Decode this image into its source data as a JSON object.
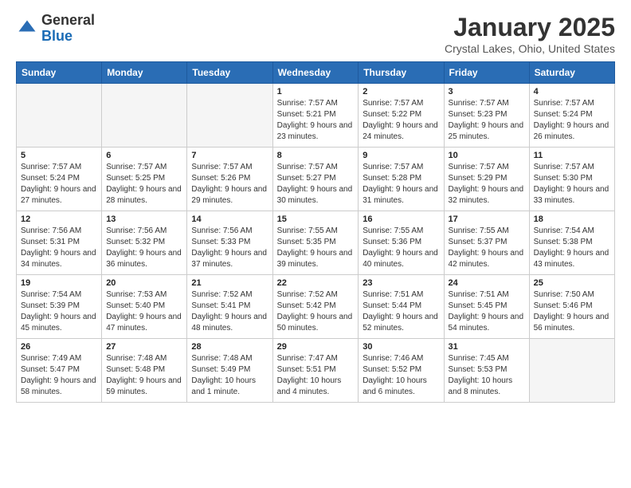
{
  "header": {
    "logo_general": "General",
    "logo_blue": "Blue",
    "month": "January 2025",
    "location": "Crystal Lakes, Ohio, United States"
  },
  "weekdays": [
    "Sunday",
    "Monday",
    "Tuesday",
    "Wednesday",
    "Thursday",
    "Friday",
    "Saturday"
  ],
  "weeks": [
    [
      {
        "day": "",
        "sunrise": "",
        "sunset": "",
        "daylight": ""
      },
      {
        "day": "",
        "sunrise": "",
        "sunset": "",
        "daylight": ""
      },
      {
        "day": "",
        "sunrise": "",
        "sunset": "",
        "daylight": ""
      },
      {
        "day": "1",
        "sunrise": "Sunrise: 7:57 AM",
        "sunset": "Sunset: 5:21 PM",
        "daylight": "Daylight: 9 hours and 23 minutes."
      },
      {
        "day": "2",
        "sunrise": "Sunrise: 7:57 AM",
        "sunset": "Sunset: 5:22 PM",
        "daylight": "Daylight: 9 hours and 24 minutes."
      },
      {
        "day": "3",
        "sunrise": "Sunrise: 7:57 AM",
        "sunset": "Sunset: 5:23 PM",
        "daylight": "Daylight: 9 hours and 25 minutes."
      },
      {
        "day": "4",
        "sunrise": "Sunrise: 7:57 AM",
        "sunset": "Sunset: 5:24 PM",
        "daylight": "Daylight: 9 hours and 26 minutes."
      }
    ],
    [
      {
        "day": "5",
        "sunrise": "Sunrise: 7:57 AM",
        "sunset": "Sunset: 5:24 PM",
        "daylight": "Daylight: 9 hours and 27 minutes."
      },
      {
        "day": "6",
        "sunrise": "Sunrise: 7:57 AM",
        "sunset": "Sunset: 5:25 PM",
        "daylight": "Daylight: 9 hours and 28 minutes."
      },
      {
        "day": "7",
        "sunrise": "Sunrise: 7:57 AM",
        "sunset": "Sunset: 5:26 PM",
        "daylight": "Daylight: 9 hours and 29 minutes."
      },
      {
        "day": "8",
        "sunrise": "Sunrise: 7:57 AM",
        "sunset": "Sunset: 5:27 PM",
        "daylight": "Daylight: 9 hours and 30 minutes."
      },
      {
        "day": "9",
        "sunrise": "Sunrise: 7:57 AM",
        "sunset": "Sunset: 5:28 PM",
        "daylight": "Daylight: 9 hours and 31 minutes."
      },
      {
        "day": "10",
        "sunrise": "Sunrise: 7:57 AM",
        "sunset": "Sunset: 5:29 PM",
        "daylight": "Daylight: 9 hours and 32 minutes."
      },
      {
        "day": "11",
        "sunrise": "Sunrise: 7:57 AM",
        "sunset": "Sunset: 5:30 PM",
        "daylight": "Daylight: 9 hours and 33 minutes."
      }
    ],
    [
      {
        "day": "12",
        "sunrise": "Sunrise: 7:56 AM",
        "sunset": "Sunset: 5:31 PM",
        "daylight": "Daylight: 9 hours and 34 minutes."
      },
      {
        "day": "13",
        "sunrise": "Sunrise: 7:56 AM",
        "sunset": "Sunset: 5:32 PM",
        "daylight": "Daylight: 9 hours and 36 minutes."
      },
      {
        "day": "14",
        "sunrise": "Sunrise: 7:56 AM",
        "sunset": "Sunset: 5:33 PM",
        "daylight": "Daylight: 9 hours and 37 minutes."
      },
      {
        "day": "15",
        "sunrise": "Sunrise: 7:55 AM",
        "sunset": "Sunset: 5:35 PM",
        "daylight": "Daylight: 9 hours and 39 minutes."
      },
      {
        "day": "16",
        "sunrise": "Sunrise: 7:55 AM",
        "sunset": "Sunset: 5:36 PM",
        "daylight": "Daylight: 9 hours and 40 minutes."
      },
      {
        "day": "17",
        "sunrise": "Sunrise: 7:55 AM",
        "sunset": "Sunset: 5:37 PM",
        "daylight": "Daylight: 9 hours and 42 minutes."
      },
      {
        "day": "18",
        "sunrise": "Sunrise: 7:54 AM",
        "sunset": "Sunset: 5:38 PM",
        "daylight": "Daylight: 9 hours and 43 minutes."
      }
    ],
    [
      {
        "day": "19",
        "sunrise": "Sunrise: 7:54 AM",
        "sunset": "Sunset: 5:39 PM",
        "daylight": "Daylight: 9 hours and 45 minutes."
      },
      {
        "day": "20",
        "sunrise": "Sunrise: 7:53 AM",
        "sunset": "Sunset: 5:40 PM",
        "daylight": "Daylight: 9 hours and 47 minutes."
      },
      {
        "day": "21",
        "sunrise": "Sunrise: 7:52 AM",
        "sunset": "Sunset: 5:41 PM",
        "daylight": "Daylight: 9 hours and 48 minutes."
      },
      {
        "day": "22",
        "sunrise": "Sunrise: 7:52 AM",
        "sunset": "Sunset: 5:42 PM",
        "daylight": "Daylight: 9 hours and 50 minutes."
      },
      {
        "day": "23",
        "sunrise": "Sunrise: 7:51 AM",
        "sunset": "Sunset: 5:44 PM",
        "daylight": "Daylight: 9 hours and 52 minutes."
      },
      {
        "day": "24",
        "sunrise": "Sunrise: 7:51 AM",
        "sunset": "Sunset: 5:45 PM",
        "daylight": "Daylight: 9 hours and 54 minutes."
      },
      {
        "day": "25",
        "sunrise": "Sunrise: 7:50 AM",
        "sunset": "Sunset: 5:46 PM",
        "daylight": "Daylight: 9 hours and 56 minutes."
      }
    ],
    [
      {
        "day": "26",
        "sunrise": "Sunrise: 7:49 AM",
        "sunset": "Sunset: 5:47 PM",
        "daylight": "Daylight: 9 hours and 58 minutes."
      },
      {
        "day": "27",
        "sunrise": "Sunrise: 7:48 AM",
        "sunset": "Sunset: 5:48 PM",
        "daylight": "Daylight: 9 hours and 59 minutes."
      },
      {
        "day": "28",
        "sunrise": "Sunrise: 7:48 AM",
        "sunset": "Sunset: 5:49 PM",
        "daylight": "Daylight: 10 hours and 1 minute."
      },
      {
        "day": "29",
        "sunrise": "Sunrise: 7:47 AM",
        "sunset": "Sunset: 5:51 PM",
        "daylight": "Daylight: 10 hours and 4 minutes."
      },
      {
        "day": "30",
        "sunrise": "Sunrise: 7:46 AM",
        "sunset": "Sunset: 5:52 PM",
        "daylight": "Daylight: 10 hours and 6 minutes."
      },
      {
        "day": "31",
        "sunrise": "Sunrise: 7:45 AM",
        "sunset": "Sunset: 5:53 PM",
        "daylight": "Daylight: 10 hours and 8 minutes."
      },
      {
        "day": "",
        "sunrise": "",
        "sunset": "",
        "daylight": ""
      }
    ]
  ]
}
